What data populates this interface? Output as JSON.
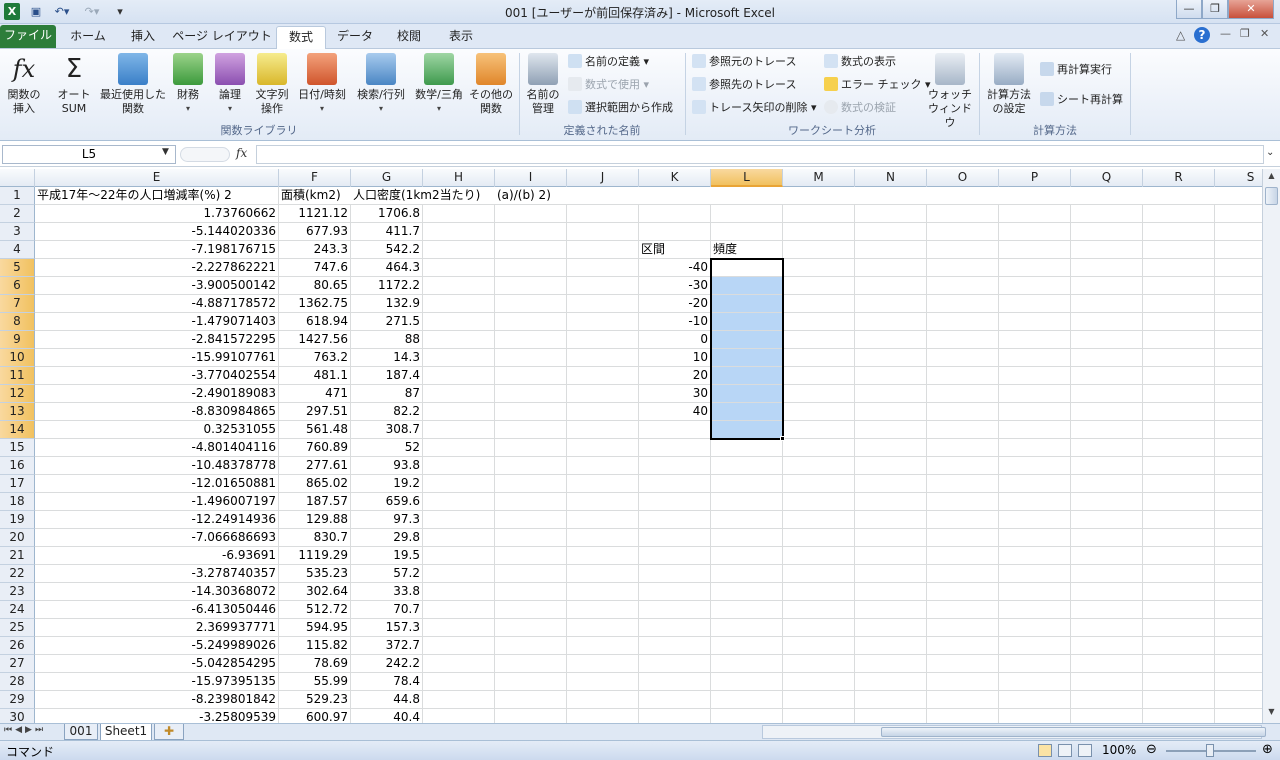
{
  "window": {
    "title": "001 [ユーザーが前回保存済み] - Microsoft Excel",
    "min": "—",
    "max": "❐",
    "close": "✕"
  },
  "tabs": [
    "ファイル",
    "ホーム",
    "挿入",
    "ページ レイアウト",
    "数式",
    "データ",
    "校閲",
    "表示"
  ],
  "ribbon": {
    "insert_function": "関数の\n挿入",
    "autosum": "オート\nSUM",
    "recent": "最近使用した\n関数",
    "financial": "財務",
    "logical": "論理",
    "text": "文字列\n操作",
    "datetime": "日付/時刻",
    "lookup": "検索/行列",
    "math": "数学/三角",
    "more": "その他の\n関数",
    "group_library": "関数ライブラリ",
    "name_manager": "名前の\n管理",
    "define_name": "名前の定義",
    "use_in_formula": "数式で使用",
    "create_from_sel": "選択範囲から作成",
    "group_names": "定義された名前",
    "trace_precedents": "参照元のトレース",
    "trace_dependents": "参照先のトレース",
    "remove_arrows": "トレース矢印の削除",
    "show_formulas": "数式の表示",
    "error_check": "エラー チェック",
    "evaluate": "数式の検証",
    "watch": "ウォッチ\nウィンドウ",
    "group_audit": "ワークシート分析",
    "calc_options": "計算方法\nの設定",
    "calc_now": "再計算実行",
    "calc_sheet": "シート再計算",
    "group_calc": "計算方法"
  },
  "namebox": "L5",
  "fx_label": "fx",
  "columns": [
    "E",
    "F",
    "G",
    "H",
    "I",
    "J",
    "K",
    "L",
    "M",
    "N",
    "O",
    "P",
    "Q",
    "R",
    "S"
  ],
  "row_numbers": [
    "1",
    "2",
    "3",
    "4",
    "5",
    "6",
    "7",
    "8",
    "9",
    "10",
    "11",
    "12",
    "13",
    "14",
    "15",
    "16",
    "17",
    "18",
    "19",
    "20",
    "21",
    "22",
    "23",
    "24",
    "25",
    "26",
    "27",
    "28",
    "29",
    "30"
  ],
  "header_row": {
    "E": "平成17年～22年の人口増減率(%) 2",
    "F": "面積(km2)",
    "G": "人口密度(1km2当たり)",
    "I": "(a)/(b) 2)"
  },
  "data_rows": [
    [
      "1.73760662",
      "1121.12",
      "1706.8"
    ],
    [
      "-5.144020336",
      "677.93",
      "411.7"
    ],
    [
      "-7.198176715",
      "243.3",
      "542.2"
    ],
    [
      "-2.227862221",
      "747.6",
      "464.3"
    ],
    [
      "-3.900500142",
      "80.65",
      "1172.2"
    ],
    [
      "-4.887178572",
      "1362.75",
      "132.9"
    ],
    [
      "-1.479071403",
      "618.94",
      "271.5"
    ],
    [
      "-2.841572295",
      "1427.56",
      "88"
    ],
    [
      "-15.99107761",
      "763.2",
      "14.3"
    ],
    [
      "-3.770402554",
      "481.1",
      "187.4"
    ],
    [
      "-2.490189083",
      "471",
      "87"
    ],
    [
      "-8.830984865",
      "297.51",
      "82.2"
    ],
    [
      "0.32531055",
      "561.48",
      "308.7"
    ],
    [
      "-4.801404116",
      "760.89",
      "52"
    ],
    [
      "-10.48378778",
      "277.61",
      "93.8"
    ],
    [
      "-12.01650881",
      "865.02",
      "19.2"
    ],
    [
      "-1.496007197",
      "187.57",
      "659.6"
    ],
    [
      "-12.24914936",
      "129.88",
      "97.3"
    ],
    [
      "-7.066686693",
      "830.7",
      "29.8"
    ],
    [
      "-6.93691",
      "1119.29",
      "19.5"
    ],
    [
      "-3.278740357",
      "535.23",
      "57.2"
    ],
    [
      "-14.30368072",
      "302.64",
      "33.8"
    ],
    [
      "-6.413050446",
      "512.72",
      "70.7"
    ],
    [
      "2.369937771",
      "594.95",
      "157.3"
    ],
    [
      "-5.249989026",
      "115.82",
      "372.7"
    ],
    [
      "-5.042854295",
      "78.69",
      "242.2"
    ],
    [
      "-15.97395135",
      "55.99",
      "78.4"
    ],
    [
      "-8.239801842",
      "529.23",
      "44.8"
    ],
    [
      "-3.25809539",
      "600.97",
      "40.4"
    ]
  ],
  "bins": {
    "label_interval": "区間",
    "label_freq": "頻度",
    "values": [
      "-40",
      "-30",
      "-20",
      "-10",
      "0",
      "10",
      "20",
      "30",
      "40"
    ]
  },
  "sheets": [
    "001",
    "Sheet1"
  ],
  "status": {
    "mode": "コマンド",
    "zoom": "100%"
  }
}
